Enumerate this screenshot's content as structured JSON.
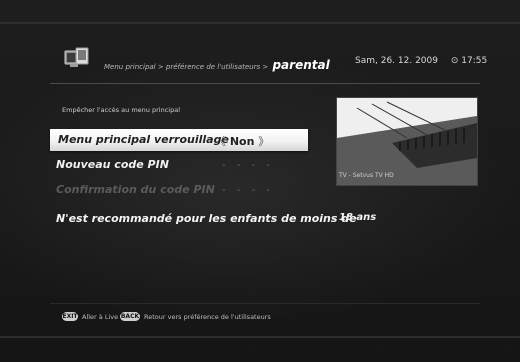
{
  "header": {
    "breadcrumb_prefix": "Menu principal > préférence de l'utilisateurs >",
    "current": "parental",
    "date": "Sam, 26. 12. 2009",
    "time": "⊙ 17:55"
  },
  "section": {
    "title": "Empêcher l'accès au menu principal"
  },
  "settings": {
    "lock": {
      "label": "Menu principal verrouillage",
      "left_arrow": "《",
      "value": "Non",
      "right_arrow": "》"
    },
    "new_pin": {
      "label": "Nouveau code PIN",
      "value": "- - - -"
    },
    "confirm_pin": {
      "label": "Confirmation du code PIN",
      "value": "- - - -"
    },
    "age": {
      "label": "N'est recommandé pour les enfants de moins de",
      "value": "18 ans"
    }
  },
  "preview": {
    "caption": "TV - Setvus TV HD"
  },
  "footer": {
    "exit_key": "EXIT",
    "exit_label": "Aller à Live",
    "back_key": "BACK",
    "back_label": "Retour vers préférence de l'utilisateurs"
  },
  "colors": {
    "highlight": "#f3f3f3",
    "background": "#1b1b1b",
    "text": "#ffffff",
    "disabled": "#5b5b5b"
  }
}
